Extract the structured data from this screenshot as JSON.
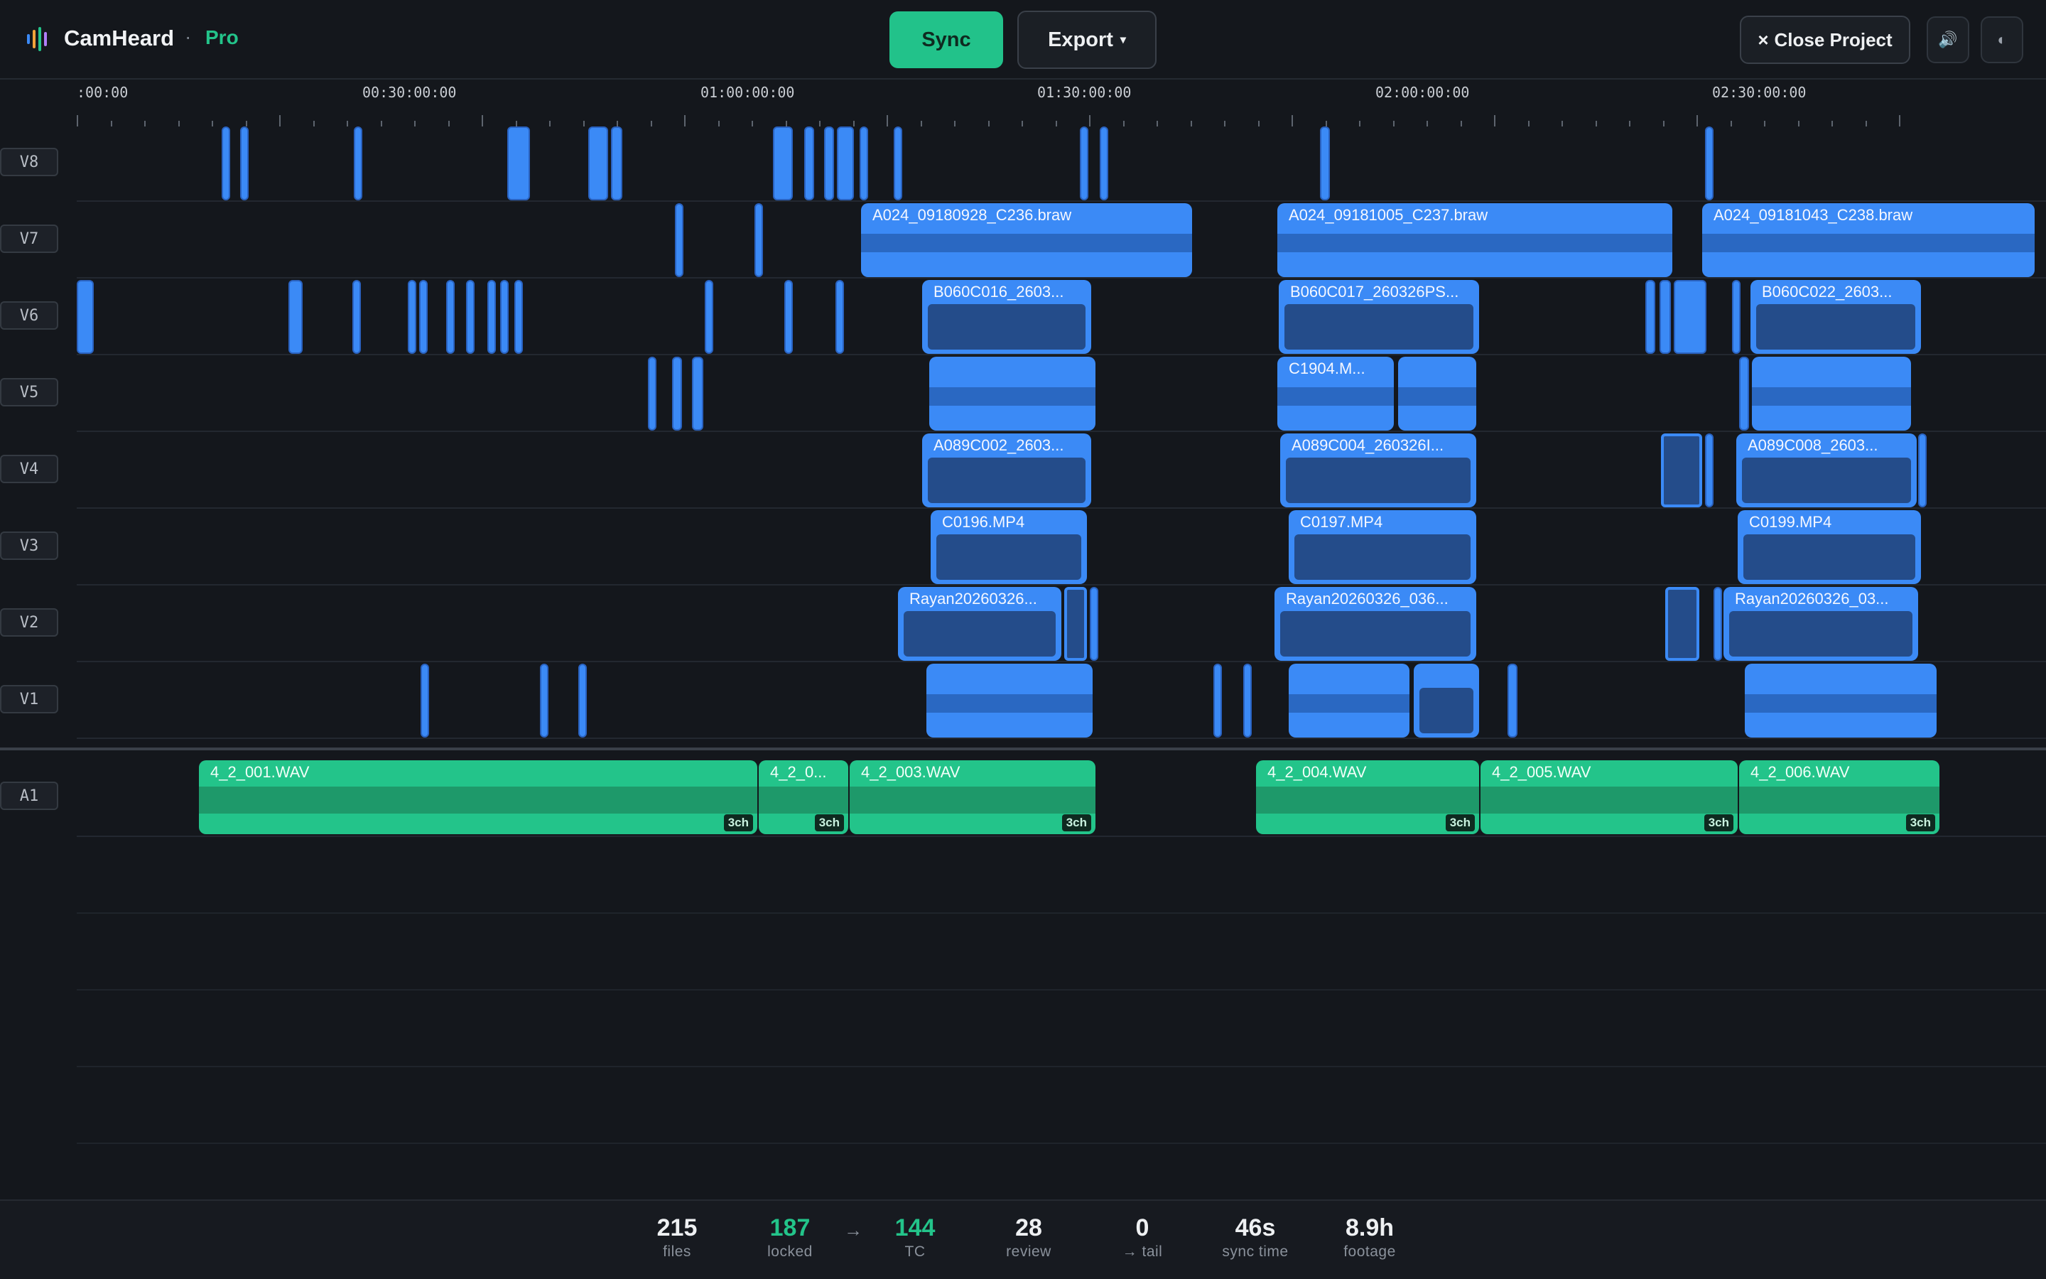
{
  "app": {
    "name": "CamHeard",
    "separator": "·",
    "plan": "Pro"
  },
  "toolbar": {
    "sync_label": "Sync",
    "export_label": "Export",
    "export_caret": "▾",
    "close_label": "Close Project",
    "close_icon": "×",
    "volume_icon": "🔊",
    "theme_icon": "◐"
  },
  "ruler": {
    "labels": [
      ":00:00",
      "00:30:00:00",
      "01:00:00:00",
      "01:30:00:00",
      "02:00:00:00",
      "02:30:00:00"
    ]
  },
  "tracks": {
    "v8": "V8",
    "v7": "V7",
    "v6": "V6",
    "v5": "V5",
    "v4": "V4",
    "v3": "V3",
    "v2": "V2",
    "v1": "V1",
    "a1": "A1"
  },
  "clips": {
    "v7_1": "A024_09180928_C236.braw",
    "v7_2": "A024_09181005_C237.braw",
    "v7_3": "A024_09181043_C238.braw",
    "v6_1": "B060C016_2603...",
    "v6_2": "B060C017_260326PS...",
    "v6_3": "B060C022_2603...",
    "v5_1": "C1904.M...",
    "v4_1": "A089C002_2603...",
    "v4_2": "A089C004_260326I...",
    "v4_3": "A089C008_2603...",
    "v3_1": "C0196.MP4",
    "v3_2": "C0197.MP4",
    "v3_3": "C0199.MP4",
    "v2_1": "Rayan20260326...",
    "v2_2": "Rayan20260326_036...",
    "v2_3": "Rayan20260326_03...",
    "a1_1": "4_2_001.WAV",
    "a1_2": "4_2_0...",
    "a1_3": "4_2_003.WAV",
    "a1_4": "4_2_004.WAV",
    "a1_5": "4_2_005.WAV",
    "a1_6": "4_2_006.WAV",
    "channels": "3ch"
  },
  "stats": {
    "files": {
      "value": "215",
      "label": "files"
    },
    "locked": {
      "value": "187",
      "label": "locked"
    },
    "arrow": "→",
    "tc": {
      "value": "144",
      "label": "TC"
    },
    "review": {
      "value": "28",
      "label": "review"
    },
    "tail": {
      "value": "0",
      "label": "→ tail"
    },
    "sync_time": {
      "value": "46s",
      "label": "sync time"
    },
    "footage": {
      "value": "8.9h",
      "label": "footage"
    }
  },
  "colors": {
    "accent_green": "#23c48a",
    "video_blue": "#3b8af6",
    "background": "#14171c"
  }
}
